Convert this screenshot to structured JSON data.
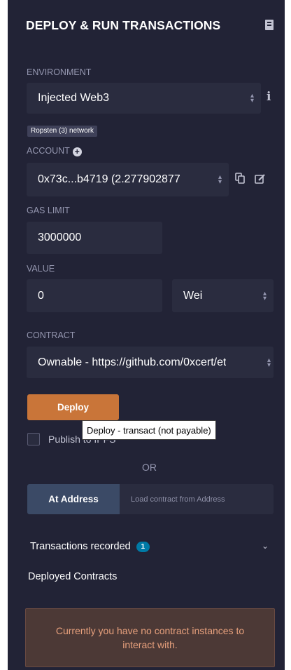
{
  "header": {
    "title": "DEPLOY & RUN TRANSACTIONS",
    "doc_icon": "book-icon"
  },
  "environment": {
    "label": "ENVIRONMENT",
    "value": "Injected Web3",
    "network_badge": "Ropsten (3) network",
    "info_icon": "info-icon"
  },
  "account": {
    "label": "ACCOUNT",
    "value": "0x73c...b4719 (2.277902877",
    "add_icon": "plus-circle-icon",
    "copy_icon": "copy-icon",
    "edit_icon": "edit-icon"
  },
  "gas_limit": {
    "label": "GAS LIMIT",
    "value": "3000000"
  },
  "value": {
    "label": "VALUE",
    "amount": "0",
    "unit": "Wei"
  },
  "contract": {
    "label": "CONTRACT",
    "value": "Ownable - https://github.com/0xcert/et"
  },
  "deploy": {
    "button_label": "Deploy",
    "tooltip": "Deploy - transact (not payable)"
  },
  "publish": {
    "label": "Publish to IPFS"
  },
  "or_text": "OR",
  "at_address": {
    "button_label": "At Address",
    "placeholder": "Load contract from Address"
  },
  "transactions": {
    "label": "Transactions recorded",
    "count": "1"
  },
  "deployed": {
    "label": "Deployed Contracts",
    "empty_message": "Currently you have no contract instances to interact with."
  },
  "colors": {
    "panel_bg": "#222336",
    "field_bg": "#2a2c3f",
    "deploy_orange": "#c97539",
    "at_address_blue": "#3b4a66",
    "badge_blue": "#007aa6",
    "alert_bg": "#4c3936",
    "alert_text": "#e8a17d"
  }
}
